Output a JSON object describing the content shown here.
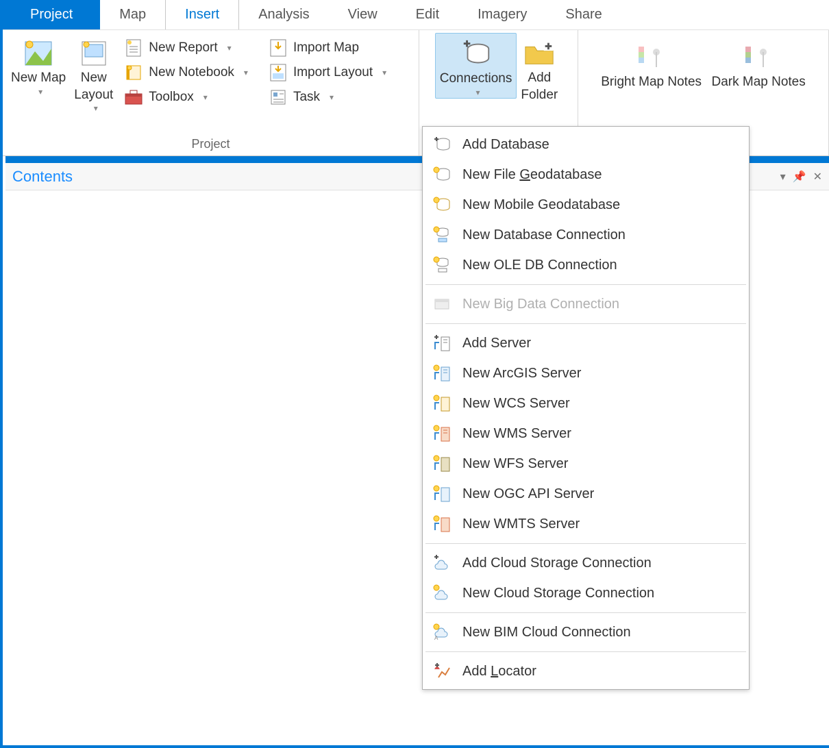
{
  "tabs": {
    "project": "Project",
    "map": "Map",
    "insert": "Insert",
    "analysis": "Analysis",
    "view": "View",
    "edit": "Edit",
    "imagery": "Imagery",
    "share": "Share"
  },
  "ribbon": {
    "new_map": "New Map",
    "new_layout": "New Layout",
    "new_report": "New Report",
    "new_notebook": "New Notebook",
    "toolbox": "Toolbox",
    "import_map": "Import Map",
    "import_layout": "Import Layout",
    "task": "Task",
    "connections": "Connections",
    "add_folder": "Add Folder",
    "bright_notes": "Bright Map Notes",
    "dark_notes": "Dark Map Notes",
    "group_project": "Project"
  },
  "pane": {
    "title": "Contents"
  },
  "menu": {
    "add_database": "Add Database",
    "new_file_geo_pre": "New File ",
    "new_file_geo_u": "G",
    "new_file_geo_post": "eodatabase",
    "new_mobile_geo": "New Mobile Geodatabase",
    "new_db_conn": "New Database Connection",
    "new_ole": "New OLE DB Connection",
    "new_bigdata": "New Big Data Connection",
    "add_server": "Add Server",
    "new_arcgis": "New ArcGIS Server",
    "new_wcs": "New WCS Server",
    "new_wms": "New WMS Server",
    "new_wfs": "New WFS Server",
    "new_ogc": "New OGC API Server",
    "new_wmts": "New WMTS Server",
    "add_cloud": "Add Cloud Storage Connection",
    "new_cloud": "New Cloud Storage Connection",
    "new_bim": "New BIM Cloud Connection",
    "add_locator_pre": "Add ",
    "add_locator_u": "L",
    "add_locator_post": "ocator"
  }
}
